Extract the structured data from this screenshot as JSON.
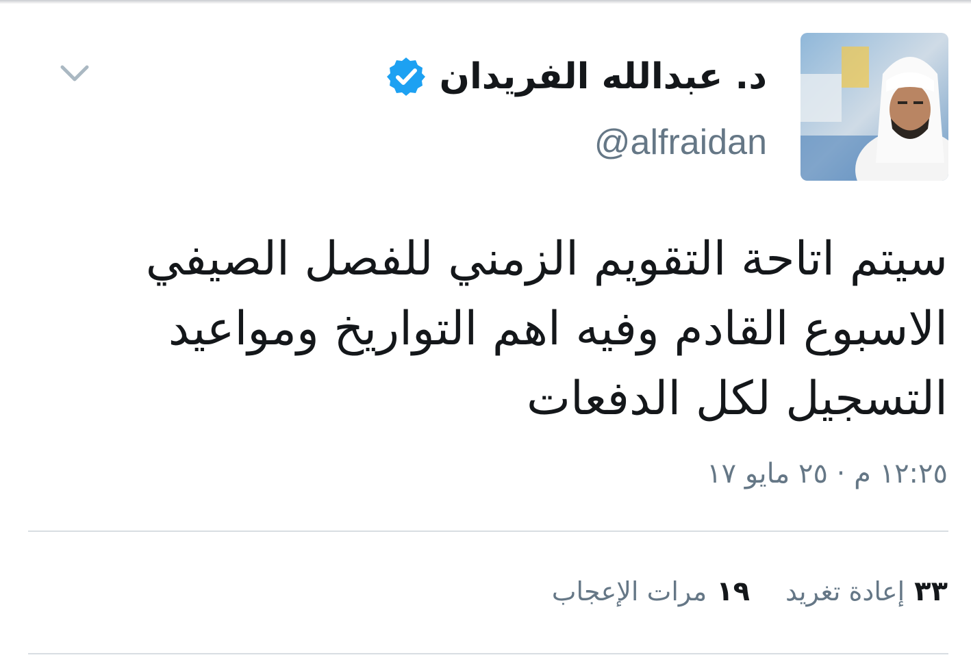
{
  "tweet": {
    "author": {
      "display_name": "د. عبدالله الفريدان",
      "handle": "@alfraidan",
      "verified": true,
      "avatar": "profile-photo-man-in-white-ghutra"
    },
    "text": "سيتم اتاحة التقويم الزمني للفصل الصيفي الاسبوع القادم وفيه اهم التواريخ ومواعيد التسجيل لكل الدفعات",
    "timestamp": "١٢:٢٥ م · ٢٥ مايو ١٧",
    "stats": {
      "retweets_count": "٣٣",
      "retweets_label": "إعادة تغريد",
      "likes_count": "١٩",
      "likes_label": "مرات الإعجاب"
    }
  },
  "icons": {
    "verified": "verified-badge-icon",
    "menu": "chevron-down-icon"
  },
  "colors": {
    "text_primary": "#14171a",
    "text_secondary": "#657786",
    "verified_blue": "#1da1f2",
    "divider": "#d8dde2"
  }
}
